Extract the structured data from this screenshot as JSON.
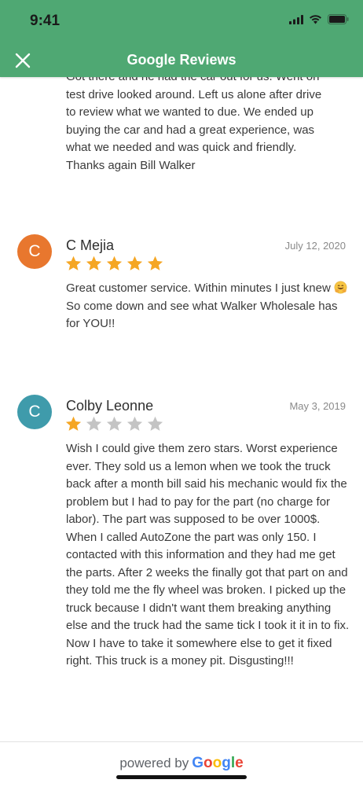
{
  "status_bar": {
    "time": "9:41"
  },
  "header": {
    "title": "Google Reviews"
  },
  "reviews": [
    {
      "text_lines": [
        "Got there and he had the car out for us. Went on",
        "test drive looked around. Left us alone after drive",
        "to review what we wanted to due. We ended up",
        "buying the car and had a great experience, was",
        "what we needed and was quick and friendly.",
        "Thanks again Bill Walker"
      ]
    },
    {
      "initial": "C",
      "author": "C Mejia",
      "date": "July 12, 2020",
      "rating": 5,
      "avatar_color": "#e8772e",
      "text_before_emoji": "Great customer service. Within minutes I just knew",
      "text_after_emoji": " So come down and see what Walker Wholesale has for YOU!!"
    },
    {
      "initial": "C",
      "author": "Colby Leonne",
      "date": "May 3, 2019",
      "rating": 1,
      "avatar_color": "#3f9bab",
      "text": "Wish I could give them zero stars. Worst experience ever. They sold us a lemon when we took the truck back after a month bill said his mechanic would fix the problem but I had to pay for the part (no charge for labor). The part was supposed to be over 1000$. When I called AutoZone the part was only 150. I contacted with this information and they had me get the parts. After 2 weeks the finally got that part on and they told me the fly wheel was broken. I picked up the truck because I didn't want them breaking anything else and the truck had the same tick I took it it in to fix. Now I have to take it somewhere else to get it fixed right. This truck is a money pit. Disgusting!!!"
    }
  ],
  "footer": {
    "powered_by": "powered by",
    "brand": "Google"
  },
  "colors": {
    "header": "#4fa873",
    "star_filled": "#f5a623",
    "star_empty": "#c4c4c4"
  }
}
